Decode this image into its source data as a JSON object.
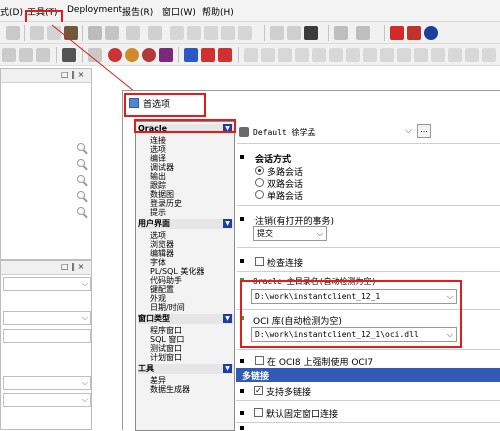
{
  "menubar": {
    "items": [
      "式(D)",
      "工具(T)",
      "Deployment",
      "报告(R)",
      "窗口(W)",
      "帮助(H)"
    ]
  },
  "left_panels": {
    "top_buttons": "□ ‖ ×",
    "mid_buttons": "□ ‖ ×"
  },
  "dialog": {
    "title": "首选项",
    "nav": {
      "oracle_head": "Oracle",
      "oracle_items": [
        "连接",
        "选项",
        "编译",
        "调试器",
        "输出",
        "跟踪",
        "数据图",
        "登录历史",
        "提示"
      ],
      "ui_head": "用户界面",
      "ui_items": [
        "选项",
        "浏览器",
        "编辑器",
        "字体",
        "PL/SQL 美化器",
        "代码助手",
        "键配置",
        "外观",
        "日期/时间"
      ],
      "wtype_head": "窗口类型",
      "wtype_items": [
        "程序窗口",
        "SQL 窗口",
        "测试窗口",
        "计划窗口"
      ],
      "tools_head": "工具",
      "tools_items": [
        "差异",
        "数据生成器"
      ]
    },
    "profile": {
      "value": "Default 徐学孟",
      "ellipsis": "..."
    },
    "session_mode": {
      "title": "会话方式",
      "options": [
        "多路会话",
        "双路会话",
        "单路会话"
      ],
      "selected": 0
    },
    "logoff": {
      "title": "注销(有打开的事务)",
      "value": "提交"
    },
    "check_connection": "检查连接",
    "oracle_home": {
      "label": "Oracle 主目录名(自动检测为空)",
      "value": "D:\\work\\instantclient_12_1"
    },
    "oci_lib": {
      "label": "OCI 库(自动检测为空)",
      "value": "D:\\work\\instantclient_12_1\\oci.dll"
    },
    "force_oci7": "在 OCI8 上强制使用 OCI7",
    "multi_connection": {
      "title": "多链接",
      "support": "支持多链接",
      "default_window": "默认固定窗口连接"
    }
  },
  "colors": {
    "highlight_red": "#e21b1b",
    "section_blue": "#3259b3"
  }
}
